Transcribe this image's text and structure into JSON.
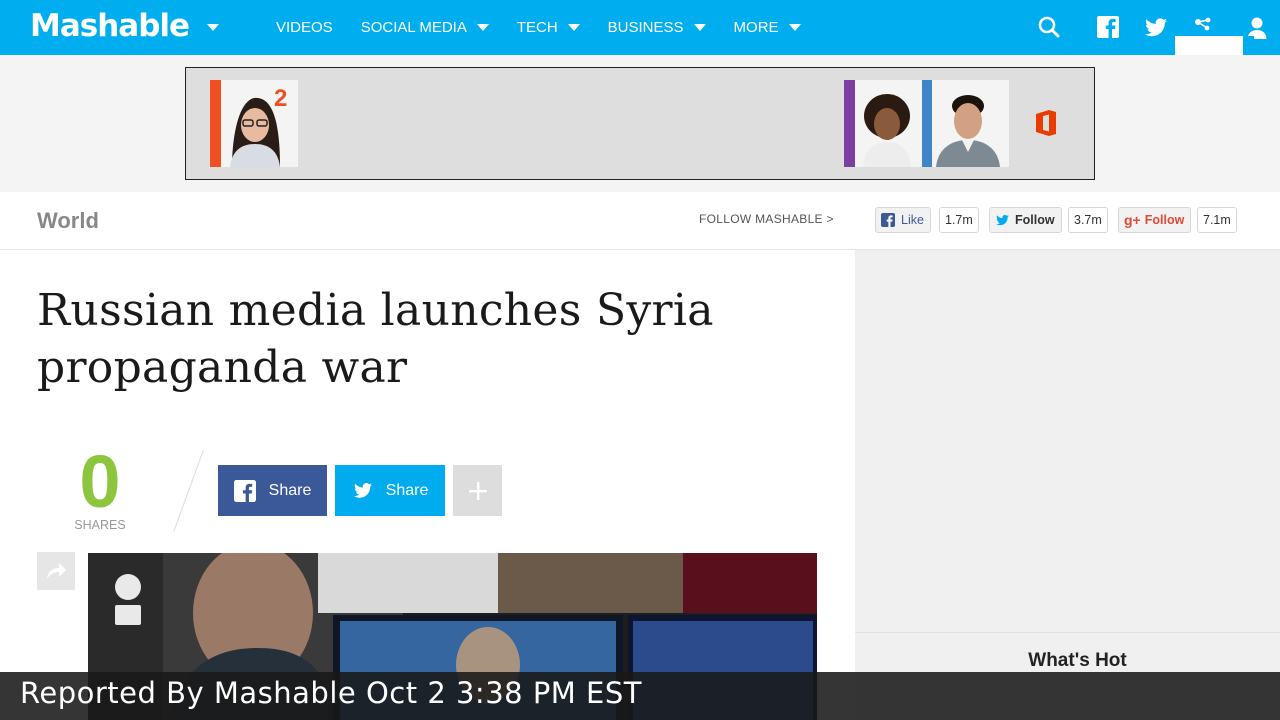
{
  "brand": {
    "name": "Mashable",
    "accent": "#00aeef"
  },
  "nav": {
    "items": [
      {
        "label": "VIDEOS",
        "has_dropdown": false
      },
      {
        "label": "SOCIAL MEDIA",
        "has_dropdown": true
      },
      {
        "label": "TECH",
        "has_dropdown": true
      },
      {
        "label": "BUSINESS",
        "has_dropdown": true
      },
      {
        "label": "MORE",
        "has_dropdown": true
      }
    ],
    "icons": [
      "search-icon",
      "facebook-icon",
      "twitter-icon",
      "share-network-icon",
      "user-icon"
    ]
  },
  "ad": {
    "badge_number": "2",
    "logo": "office-icon"
  },
  "section": {
    "title": "World",
    "follow_label": "FOLLOW MASHABLE >",
    "social": [
      {
        "network": "facebook",
        "label": "Like",
        "count": "1.7m"
      },
      {
        "network": "twitter",
        "label": "Follow",
        "count": "3.7m"
      },
      {
        "network": "googleplus",
        "label": "Follow",
        "count": "7.1m"
      }
    ]
  },
  "article": {
    "headline": "Russian media launches Syria propaganda war",
    "share_count": "0",
    "shares_label": "SHARES",
    "buttons": {
      "facebook_share": "Share",
      "twitter_share": "Share"
    }
  },
  "sidebar": {
    "whats_hot": "What's Hot"
  },
  "overlay": {
    "caption": "Reported By Mashable Oct 2 3:38 PM EST"
  },
  "colors": {
    "facebook": "#3b5998",
    "twitter": "#00aced",
    "googleplus": "#dd4b39",
    "share_count": "#8cc63f"
  }
}
